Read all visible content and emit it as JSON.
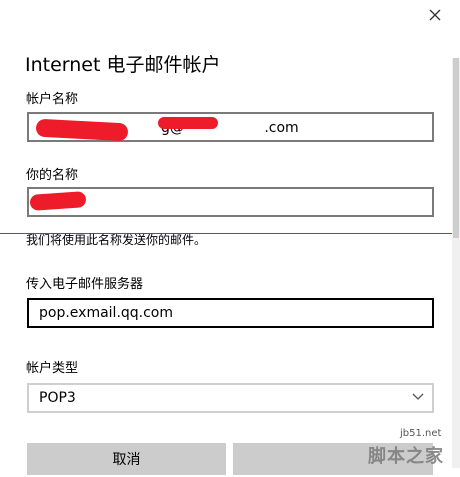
{
  "dialog": {
    "title": "Internet 电子邮件帐户",
    "close_icon": "close-icon"
  },
  "fields": {
    "account_name": {
      "label": "帐户名称",
      "visible_value": "g@ .com"
    },
    "your_name": {
      "label": "你的名称",
      "hint": "我们将使用此名称发送你的邮件。"
    },
    "incoming_server": {
      "label": "传入电子邮件服务器",
      "value": "pop.exmail.qq.com"
    },
    "account_type": {
      "label": "帐户类型",
      "selected": "POP3"
    }
  },
  "buttons": {
    "cancel": "取消"
  },
  "watermark": {
    "site": "jb51.net",
    "name": "脚本之家"
  },
  "colors": {
    "redaction": "#ee1b2b",
    "field_border": "#7a7a7a",
    "button_bg": "#cccccc"
  }
}
